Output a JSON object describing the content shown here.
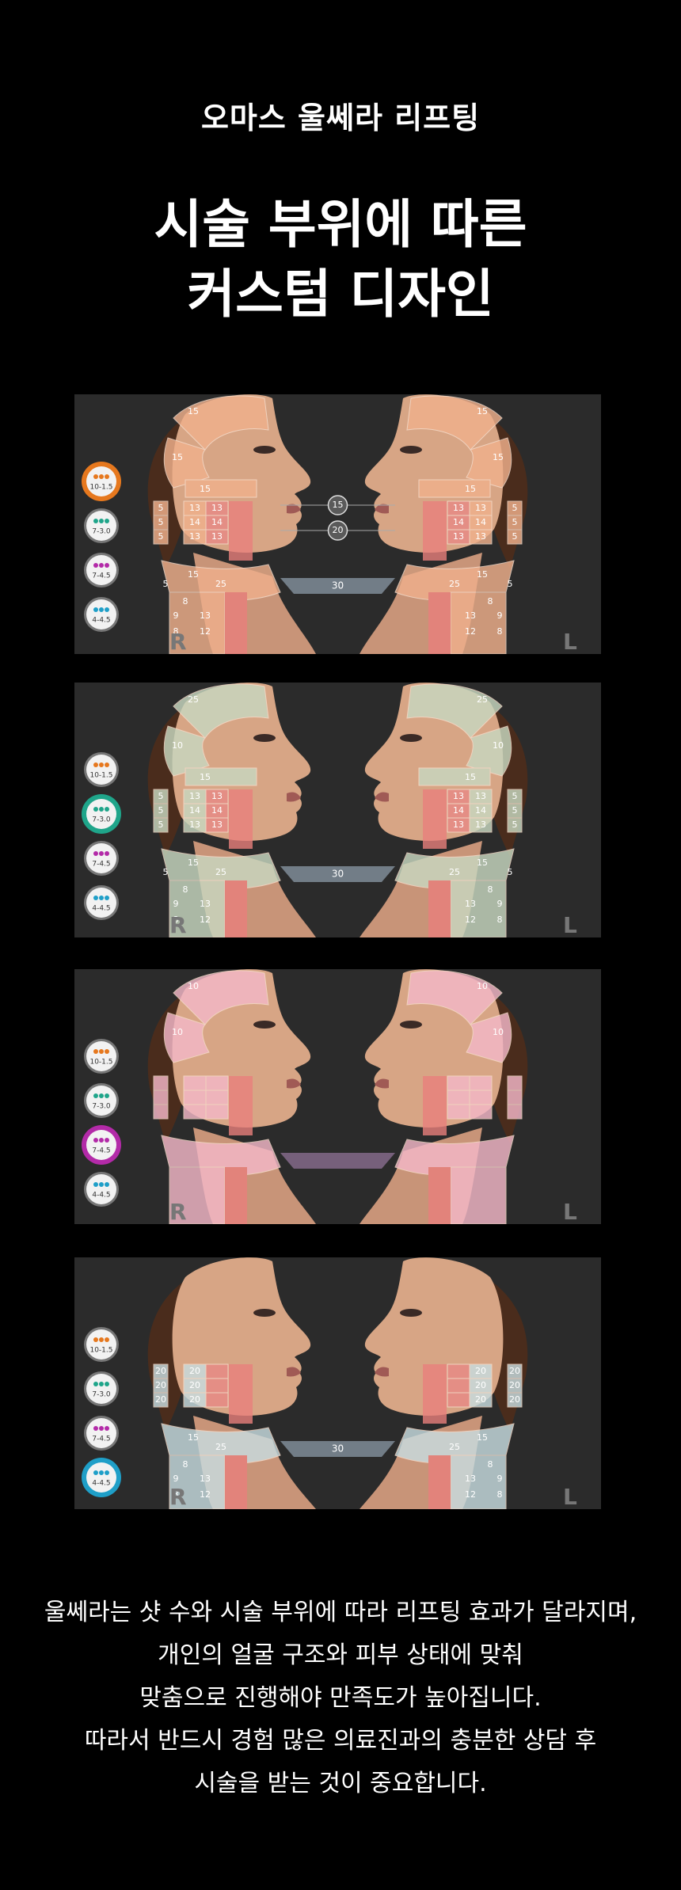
{
  "header": {
    "subtitle": "오마스 울쎄라 리프팅",
    "title_lines": [
      "시술 부위에 따른",
      "커스텀 디자인"
    ]
  },
  "panels": [
    {
      "selected": 0,
      "tint": "#f0b08c",
      "side_labels": [
        "R",
        "L"
      ],
      "legend": [
        {
          "label": "10-1.5",
          "dot": "#e6781e"
        },
        {
          "label": "7-3.0",
          "dot": "#1fa58a"
        },
        {
          "label": "7-4.5",
          "dot": "#b32aa8"
        },
        {
          "label": "4-4.5",
          "dot": "#1f9fc8"
        }
      ],
      "forehead": "15",
      "temple_a": "15",
      "temple_b": "15",
      "cheek_top": "15",
      "center_badges": [
        "15",
        "20"
      ],
      "neck_band": "30",
      "face_grid": [
        "5",
        "13",
        "13",
        "5",
        "14",
        "14",
        "5",
        "13",
        "13"
      ],
      "neck_nums": [
        "15",
        "25",
        "8",
        "5",
        "9",
        "13",
        "8",
        "12"
      ]
    },
    {
      "selected": 1,
      "tint": "#c8d8c0",
      "side_labels": [
        "R",
        "L"
      ],
      "legend": [
        {
          "label": "10-1.5",
          "dot": "#e6781e"
        },
        {
          "label": "7-3.0",
          "dot": "#1fa58a"
        },
        {
          "label": "7-4.5",
          "dot": "#b32aa8"
        },
        {
          "label": "4-4.5",
          "dot": "#1f9fc8"
        }
      ],
      "forehead": "25",
      "temple_a": "10",
      "temple_b": "10",
      "cheek_top": "15",
      "center_badges": [],
      "neck_band": "30",
      "face_grid": [
        "5",
        "13",
        "13",
        "5",
        "14",
        "14",
        "5",
        "13",
        "13"
      ],
      "neck_nums": [
        "15",
        "25",
        "8",
        "5",
        "9",
        "13",
        "8",
        "12"
      ]
    },
    {
      "selected": 2,
      "tint": "#f4b8c8",
      "side_labels": [
        "R",
        "L"
      ],
      "legend": [
        {
          "label": "10-1.5",
          "dot": "#e6781e"
        },
        {
          "label": "7-3.0",
          "dot": "#1fa58a"
        },
        {
          "label": "7-4.5",
          "dot": "#b32aa8"
        },
        {
          "label": "4-4.5",
          "dot": "#1f9fc8"
        }
      ],
      "forehead": "10",
      "temple_a": "10",
      "temple_b": "10",
      "cheek_top": "",
      "center_badges": [],
      "neck_band": "",
      "face_grid": [
        "",
        "",
        "",
        "",
        "",
        "",
        "",
        "",
        ""
      ],
      "neck_nums": [
        "",
        "",
        "",
        "",
        "",
        "",
        "",
        ""
      ]
    },
    {
      "selected": 3,
      "tint": "#c8dce0",
      "side_labels": [
        "R",
        "L"
      ],
      "legend": [
        {
          "label": "10-1.5",
          "dot": "#e6781e"
        },
        {
          "label": "7-3.0",
          "dot": "#1fa58a"
        },
        {
          "label": "7-4.5",
          "dot": "#b32aa8"
        },
        {
          "label": "4-4.5",
          "dot": "#1f9fc8"
        }
      ],
      "forehead": "",
      "temple_a": "",
      "temple_b": "",
      "cheek_top": "",
      "center_badges": [],
      "neck_band": "30",
      "face_grid": [
        "20",
        "20",
        "",
        "20",
        "20",
        "",
        "20",
        "20",
        ""
      ],
      "neck_nums": [
        "15",
        "25",
        "8",
        "",
        "9",
        "13",
        "8",
        "12"
      ]
    }
  ],
  "body": {
    "lines": [
      "울쎄라는 샷 수와 시술 부위에 따라 리프팅 효과가 달라지며,",
      "개인의 얼굴 구조와 피부 상태에 맞춰",
      "맞춤으로 진행해야 만족도가 높아집니다.",
      "따라서 반드시 경험 많은 의료진과의 충분한 상담 후",
      "시술을 받는 것이 중요합니다."
    ]
  }
}
